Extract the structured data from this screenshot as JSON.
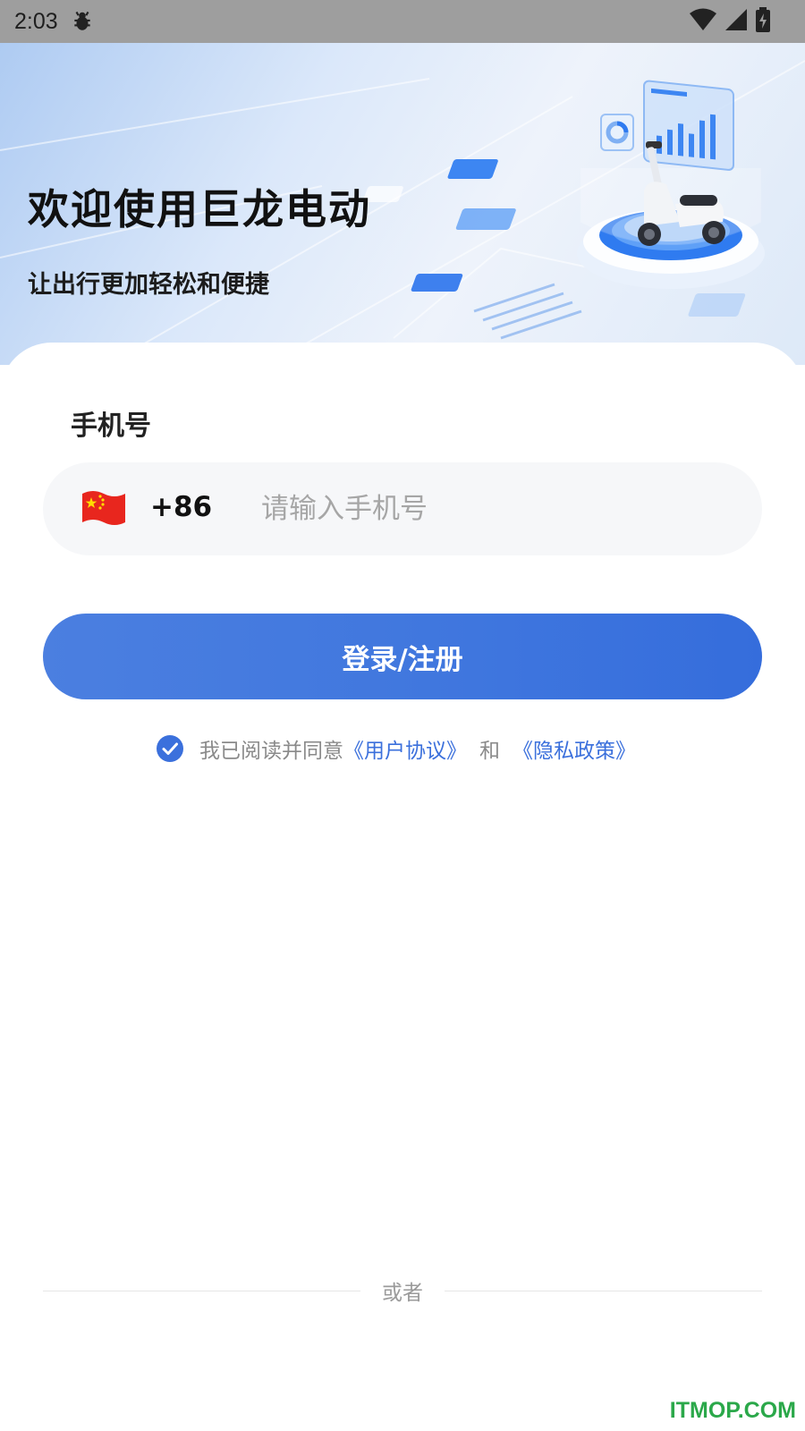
{
  "status_bar": {
    "time": "2:03",
    "icons": [
      "debug-icon",
      "wifi-icon",
      "signal-icon",
      "battery-charging-icon"
    ]
  },
  "hero": {
    "title": "欢迎使用巨龙电动",
    "subtitle": "让出行更加轻松和便捷",
    "illustration": "scooter-platform-illustration"
  },
  "login": {
    "phone_label": "手机号",
    "country_code": "+86",
    "flag_icon": "china-flag-icon",
    "phone_value": "",
    "phone_placeholder": "请输入手机号",
    "button_label": "登录/注册"
  },
  "agreement": {
    "checked": true,
    "prefix": "我已阅读并同意",
    "user_agreement": "《用户协议》",
    "and": "和",
    "privacy_policy": "《隐私政策》"
  },
  "divider": {
    "text": "或者"
  },
  "watermark": "ITMOP.COM",
  "colors": {
    "primary": "#3F76DE",
    "link": "#3B70DC",
    "input_bg": "#F6F7F9",
    "watermark": "#2BA84A"
  }
}
